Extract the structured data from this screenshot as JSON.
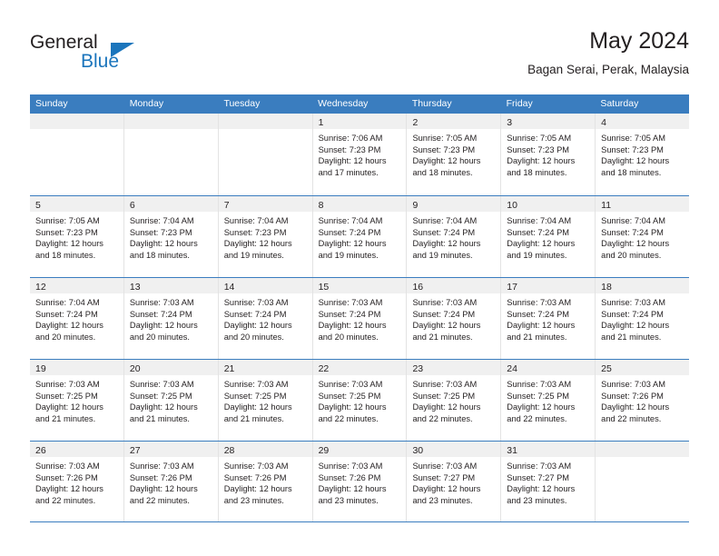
{
  "brand": {
    "name_primary": "General",
    "name_secondary": "Blue",
    "logo_icon": "triangle-logo-icon"
  },
  "header": {
    "title": "May 2024",
    "subtitle": "Bagan Serai, Perak, Malaysia"
  },
  "colors": {
    "header_band": "#3a7dbf",
    "daynum_band": "#f0f0f0",
    "brand_blue": "#1b75bc",
    "text": "#231f20",
    "cell_divider": "#e3e3e3"
  },
  "weekdays": [
    "Sunday",
    "Monday",
    "Tuesday",
    "Wednesday",
    "Thursday",
    "Friday",
    "Saturday"
  ],
  "weeks": [
    [
      {
        "day": "",
        "lines": []
      },
      {
        "day": "",
        "lines": []
      },
      {
        "day": "",
        "lines": []
      },
      {
        "day": "1",
        "lines": [
          "Sunrise: 7:06 AM",
          "Sunset: 7:23 PM",
          "Daylight: 12 hours",
          "and 17 minutes."
        ]
      },
      {
        "day": "2",
        "lines": [
          "Sunrise: 7:05 AM",
          "Sunset: 7:23 PM",
          "Daylight: 12 hours",
          "and 18 minutes."
        ]
      },
      {
        "day": "3",
        "lines": [
          "Sunrise: 7:05 AM",
          "Sunset: 7:23 PM",
          "Daylight: 12 hours",
          "and 18 minutes."
        ]
      },
      {
        "day": "4",
        "lines": [
          "Sunrise: 7:05 AM",
          "Sunset: 7:23 PM",
          "Daylight: 12 hours",
          "and 18 minutes."
        ]
      }
    ],
    [
      {
        "day": "5",
        "lines": [
          "Sunrise: 7:05 AM",
          "Sunset: 7:23 PM",
          "Daylight: 12 hours",
          "and 18 minutes."
        ]
      },
      {
        "day": "6",
        "lines": [
          "Sunrise: 7:04 AM",
          "Sunset: 7:23 PM",
          "Daylight: 12 hours",
          "and 18 minutes."
        ]
      },
      {
        "day": "7",
        "lines": [
          "Sunrise: 7:04 AM",
          "Sunset: 7:23 PM",
          "Daylight: 12 hours",
          "and 19 minutes."
        ]
      },
      {
        "day": "8",
        "lines": [
          "Sunrise: 7:04 AM",
          "Sunset: 7:24 PM",
          "Daylight: 12 hours",
          "and 19 minutes."
        ]
      },
      {
        "day": "9",
        "lines": [
          "Sunrise: 7:04 AM",
          "Sunset: 7:24 PM",
          "Daylight: 12 hours",
          "and 19 minutes."
        ]
      },
      {
        "day": "10",
        "lines": [
          "Sunrise: 7:04 AM",
          "Sunset: 7:24 PM",
          "Daylight: 12 hours",
          "and 19 minutes."
        ]
      },
      {
        "day": "11",
        "lines": [
          "Sunrise: 7:04 AM",
          "Sunset: 7:24 PM",
          "Daylight: 12 hours",
          "and 20 minutes."
        ]
      }
    ],
    [
      {
        "day": "12",
        "lines": [
          "Sunrise: 7:04 AM",
          "Sunset: 7:24 PM",
          "Daylight: 12 hours",
          "and 20 minutes."
        ]
      },
      {
        "day": "13",
        "lines": [
          "Sunrise: 7:03 AM",
          "Sunset: 7:24 PM",
          "Daylight: 12 hours",
          "and 20 minutes."
        ]
      },
      {
        "day": "14",
        "lines": [
          "Sunrise: 7:03 AM",
          "Sunset: 7:24 PM",
          "Daylight: 12 hours",
          "and 20 minutes."
        ]
      },
      {
        "day": "15",
        "lines": [
          "Sunrise: 7:03 AM",
          "Sunset: 7:24 PM",
          "Daylight: 12 hours",
          "and 20 minutes."
        ]
      },
      {
        "day": "16",
        "lines": [
          "Sunrise: 7:03 AM",
          "Sunset: 7:24 PM",
          "Daylight: 12 hours",
          "and 21 minutes."
        ]
      },
      {
        "day": "17",
        "lines": [
          "Sunrise: 7:03 AM",
          "Sunset: 7:24 PM",
          "Daylight: 12 hours",
          "and 21 minutes."
        ]
      },
      {
        "day": "18",
        "lines": [
          "Sunrise: 7:03 AM",
          "Sunset: 7:24 PM",
          "Daylight: 12 hours",
          "and 21 minutes."
        ]
      }
    ],
    [
      {
        "day": "19",
        "lines": [
          "Sunrise: 7:03 AM",
          "Sunset: 7:25 PM",
          "Daylight: 12 hours",
          "and 21 minutes."
        ]
      },
      {
        "day": "20",
        "lines": [
          "Sunrise: 7:03 AM",
          "Sunset: 7:25 PM",
          "Daylight: 12 hours",
          "and 21 minutes."
        ]
      },
      {
        "day": "21",
        "lines": [
          "Sunrise: 7:03 AM",
          "Sunset: 7:25 PM",
          "Daylight: 12 hours",
          "and 21 minutes."
        ]
      },
      {
        "day": "22",
        "lines": [
          "Sunrise: 7:03 AM",
          "Sunset: 7:25 PM",
          "Daylight: 12 hours",
          "and 22 minutes."
        ]
      },
      {
        "day": "23",
        "lines": [
          "Sunrise: 7:03 AM",
          "Sunset: 7:25 PM",
          "Daylight: 12 hours",
          "and 22 minutes."
        ]
      },
      {
        "day": "24",
        "lines": [
          "Sunrise: 7:03 AM",
          "Sunset: 7:25 PM",
          "Daylight: 12 hours",
          "and 22 minutes."
        ]
      },
      {
        "day": "25",
        "lines": [
          "Sunrise: 7:03 AM",
          "Sunset: 7:26 PM",
          "Daylight: 12 hours",
          "and 22 minutes."
        ]
      }
    ],
    [
      {
        "day": "26",
        "lines": [
          "Sunrise: 7:03 AM",
          "Sunset: 7:26 PM",
          "Daylight: 12 hours",
          "and 22 minutes."
        ]
      },
      {
        "day": "27",
        "lines": [
          "Sunrise: 7:03 AM",
          "Sunset: 7:26 PM",
          "Daylight: 12 hours",
          "and 22 minutes."
        ]
      },
      {
        "day": "28",
        "lines": [
          "Sunrise: 7:03 AM",
          "Sunset: 7:26 PM",
          "Daylight: 12 hours",
          "and 23 minutes."
        ]
      },
      {
        "day": "29",
        "lines": [
          "Sunrise: 7:03 AM",
          "Sunset: 7:26 PM",
          "Daylight: 12 hours",
          "and 23 minutes."
        ]
      },
      {
        "day": "30",
        "lines": [
          "Sunrise: 7:03 AM",
          "Sunset: 7:27 PM",
          "Daylight: 12 hours",
          "and 23 minutes."
        ]
      },
      {
        "day": "31",
        "lines": [
          "Sunrise: 7:03 AM",
          "Sunset: 7:27 PM",
          "Daylight: 12 hours",
          "and 23 minutes."
        ]
      },
      {
        "day": "",
        "lines": []
      }
    ]
  ]
}
